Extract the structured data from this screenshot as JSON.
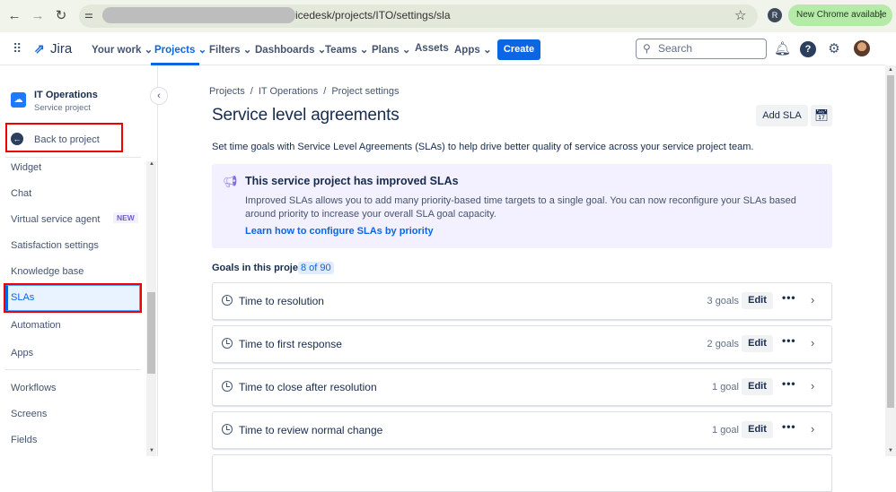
{
  "browser": {
    "url": "icedesk/projects/ITO/settings/sla",
    "profile": "R",
    "update_label": "New Chrome available"
  },
  "nav": {
    "logo": "Jira",
    "items": [
      "Your work",
      "Projects",
      "Filters",
      "Dashboards",
      "Teams",
      "Plans",
      "Assets",
      "Apps"
    ],
    "create": "Create",
    "search_placeholder": "Search"
  },
  "sidebar": {
    "project_name": "IT Operations",
    "project_type": "Service project",
    "back": "Back to project",
    "items": [
      "Widget",
      "Chat",
      "Virtual service agent",
      "Satisfaction settings",
      "Knowledge base",
      "SLAs",
      "Automation",
      "Apps"
    ],
    "new_badge": "NEW",
    "items2": [
      "Workflows",
      "Screens",
      "Fields"
    ]
  },
  "main": {
    "breadcrumbs": [
      "Projects",
      "IT Operations",
      "Project settings"
    ],
    "title": "Service level agreements",
    "add_sla": "Add SLA",
    "description": "Set time goals with Service Level Agreements (SLAs) to help drive better quality of service across your service project team.",
    "banner": {
      "title": "This service project has improved SLAs",
      "text": "Improved SLAs allows you to add many priority-based time targets to a single goal. You can now reconfigure your SLAs based around priority to increase your overall SLA goal capacity.",
      "link": "Learn how to configure SLAs by priority"
    },
    "goals_label": "Goals in this project:",
    "goals_count": "8 of 90",
    "slas": [
      {
        "name": "Time to resolution",
        "goals": "3 goals"
      },
      {
        "name": "Time to first response",
        "goals": "2 goals"
      },
      {
        "name": "Time to close after resolution",
        "goals": "1 goal"
      },
      {
        "name": "Time to review normal change",
        "goals": "1 goal"
      }
    ],
    "edit": "Edit"
  }
}
